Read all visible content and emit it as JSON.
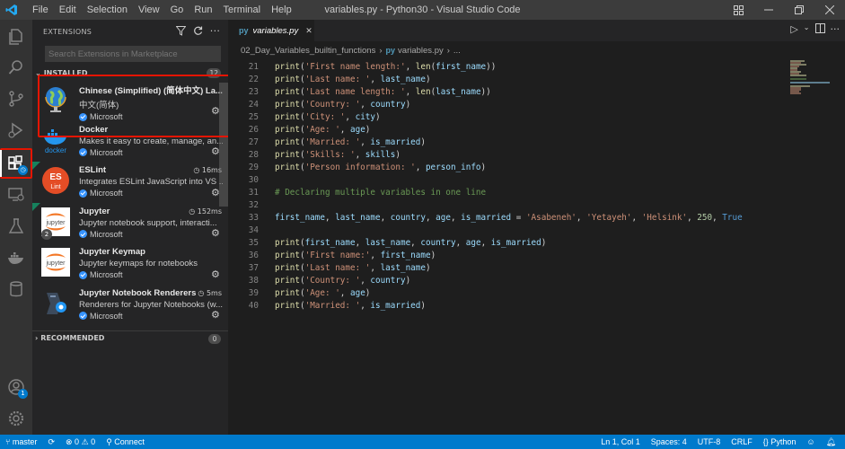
{
  "window": {
    "title": "variables.py - Python30 - Visual Studio Code",
    "menu": [
      "File",
      "Edit",
      "Selection",
      "View",
      "Go",
      "Run",
      "Terminal",
      "Help"
    ]
  },
  "sidebar": {
    "title": "EXTENSIONS",
    "search_placeholder": "Search Extensions in Marketplace",
    "installed_label": "INSTALLED",
    "installed_count": "12",
    "recommended_label": "RECOMMENDED",
    "recommended_count": "0",
    "extensions": [
      {
        "name": "Chinese (Simplified) (简体中文) La...",
        "desc": "中文(简体)",
        "publisher": "Microsoft",
        "time": "",
        "icon": "globe-icon"
      },
      {
        "name": "Docker",
        "desc": "Makes it easy to create, manage, an...",
        "publisher": "Microsoft",
        "time": "",
        "icon": "docker-icon"
      },
      {
        "name": "ESLint",
        "desc": "Integrates ESLint JavaScript into VS ...",
        "publisher": "Microsoft",
        "time": "16ms",
        "icon": "eslint-icon"
      },
      {
        "name": "Jupyter",
        "desc": "Jupyter notebook support, interacti...",
        "publisher": "Microsoft",
        "time": "152ms",
        "icon": "jupyter-icon",
        "badge": "2"
      },
      {
        "name": "Jupyter Keymap",
        "desc": "Jupyter keymaps for notebooks",
        "publisher": "Microsoft",
        "time": "",
        "icon": "jupyter-icon"
      },
      {
        "name": "Jupyter Notebook Renderers",
        "desc": "Renderers for Jupyter Notebooks (w...",
        "publisher": "Microsoft",
        "time": "5ms",
        "icon": "renderer-icon"
      }
    ]
  },
  "editor": {
    "tab_label": "variables.py",
    "tab_icon_text": "py",
    "breadcrumb_folder": "02_Day_Variables_builtin_functions",
    "breadcrumb_file": "variables.py",
    "breadcrumb_more": "...",
    "lines": [
      {
        "n": "21",
        "code": "print('First name length:', len(first_name))"
      },
      {
        "n": "22",
        "code": "print('Last name: ', last_name)"
      },
      {
        "n": "23",
        "code": "print('Last name length: ', len(last_name))"
      },
      {
        "n": "24",
        "code": "print('Country: ', country)"
      },
      {
        "n": "25",
        "code": "print('City: ', city)"
      },
      {
        "n": "26",
        "code": "print('Age: ', age)"
      },
      {
        "n": "27",
        "code": "print('Married: ', is_married)"
      },
      {
        "n": "28",
        "code": "print('Skills: ', skills)"
      },
      {
        "n": "29",
        "code": "print('Person information: ', person_info)"
      },
      {
        "n": "30",
        "code": ""
      },
      {
        "n": "31",
        "code": "# Declaring multiple variables in one line"
      },
      {
        "n": "32",
        "code": ""
      },
      {
        "n": "33",
        "code": "first_name, last_name, country, age, is_married = 'Asabeneh', 'Yetayeh', 'Helsink', 250, True"
      },
      {
        "n": "34",
        "code": ""
      },
      {
        "n": "35",
        "code": "print(first_name, last_name, country, age, is_married)"
      },
      {
        "n": "36",
        "code": "print('First name:', first_name)"
      },
      {
        "n": "37",
        "code": "print('Last name: ', last_name)"
      },
      {
        "n": "38",
        "code": "print('Country: ', country)"
      },
      {
        "n": "39",
        "code": "print('Age: ', age)"
      },
      {
        "n": "40",
        "code": "print('Married: ', is_married)"
      }
    ]
  },
  "status": {
    "branch": "master",
    "errors": "0",
    "warnings": "0",
    "connect": "Connect",
    "position": "Ln 1, Col 1",
    "spaces": "Spaces: 4",
    "encoding": "UTF-8",
    "eol": "CRLF",
    "language": "Python"
  },
  "colors": {
    "accent": "#007acc",
    "highlight": "#e51400"
  }
}
